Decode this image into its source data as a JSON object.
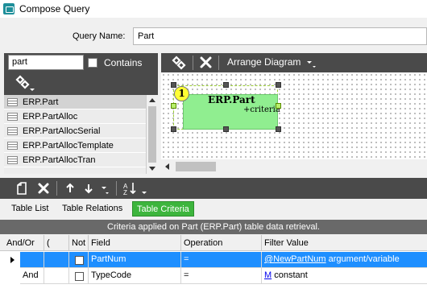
{
  "window": {
    "title": "Compose Query"
  },
  "query": {
    "name_label": "Query Name:",
    "name_value": "Part"
  },
  "search": {
    "value": "part",
    "contains_label": "Contains"
  },
  "tables": [
    {
      "label": "ERP.Part"
    },
    {
      "label": "ERP.PartAlloc"
    },
    {
      "label": "ERP.PartAllocSerial"
    },
    {
      "label": "ERP.PartAllocTemplate"
    },
    {
      "label": "ERP.PartAllocTran"
    }
  ],
  "diagram": {
    "arrange_label": "Arrange Diagram",
    "node": {
      "badge": "1",
      "title": "ERP.Part",
      "subtitle": "+criteria"
    }
  },
  "tabs": [
    {
      "label": "Table List"
    },
    {
      "label": "Table Relations"
    },
    {
      "label": "Table Criteria"
    }
  ],
  "criteria": {
    "banner": "Criteria applied on Part (ERP.Part)  table data retrieval.",
    "columns": [
      "And/Or",
      "(",
      "Not",
      "Field",
      "Operation",
      "Filter Value"
    ],
    "rows": [
      {
        "andor": "",
        "paren": "",
        "field": "PartNum",
        "operation": "=",
        "filter_link": "@NewPartNum",
        "filter_text": "argument/variable"
      },
      {
        "andor": "And",
        "paren": "",
        "field": "TypeCode",
        "operation": "=",
        "filter_link": "M",
        "filter_text": "constant"
      }
    ]
  },
  "colors": {
    "active_tab": "#3db53d",
    "selection": "#1e8fff",
    "node_fill": "#90ee90",
    "toolbar": "#4a4a4a"
  }
}
